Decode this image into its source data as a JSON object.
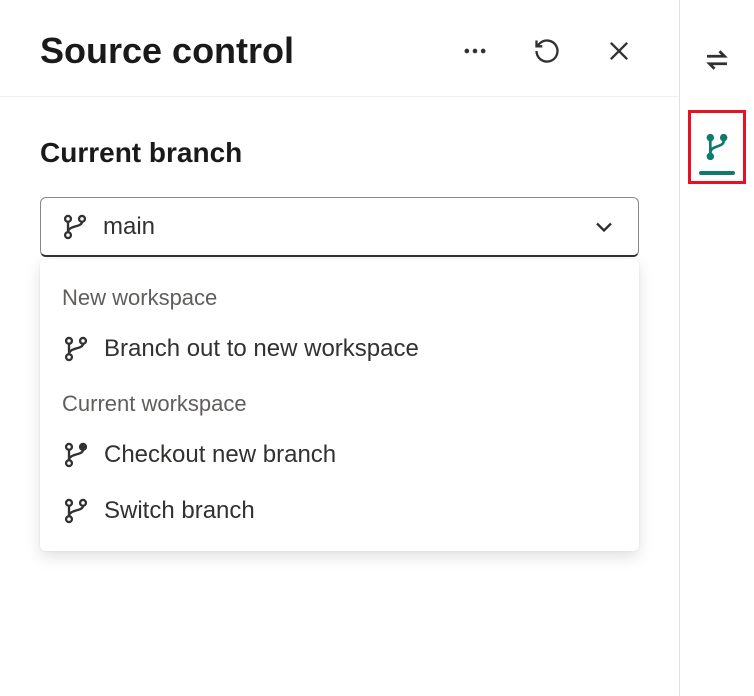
{
  "header": {
    "title": "Source control"
  },
  "section": {
    "label": "Current branch"
  },
  "dropdown": {
    "selected": "main",
    "groups": [
      {
        "label": "New workspace",
        "items": [
          {
            "label": "Branch out to new workspace",
            "icon": "branch"
          }
        ]
      },
      {
        "label": "Current workspace",
        "items": [
          {
            "label": "Checkout new branch",
            "icon": "branch-new"
          },
          {
            "label": "Switch branch",
            "icon": "branch"
          }
        ]
      }
    ]
  }
}
